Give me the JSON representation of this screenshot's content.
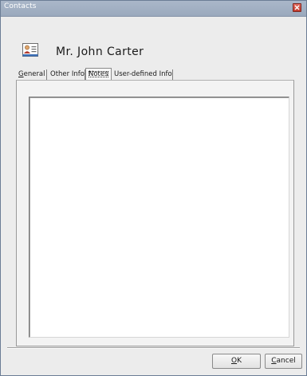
{
  "window": {
    "title": "Contacts"
  },
  "header": {
    "icon": "contact-card-icon",
    "name": "Mr. John Carter"
  },
  "tabs": [
    {
      "mnemonic": "G",
      "rest": "eneral",
      "active": false
    },
    {
      "mnemonic": "",
      "rest": "Other Info",
      "active": false
    },
    {
      "mnemonic": "",
      "rest": "Notes",
      "active": true
    },
    {
      "mnemonic": "",
      "rest": "User-defined Info",
      "active": false
    }
  ],
  "notes": {
    "value": ""
  },
  "buttons": {
    "ok": {
      "mnemonic": "O",
      "rest": "K"
    },
    "cancel": {
      "mnemonic": "C",
      "rest": "ancel"
    }
  },
  "colors": {
    "titlebar": "#9aa9bd",
    "close_button": "#c2392b"
  }
}
